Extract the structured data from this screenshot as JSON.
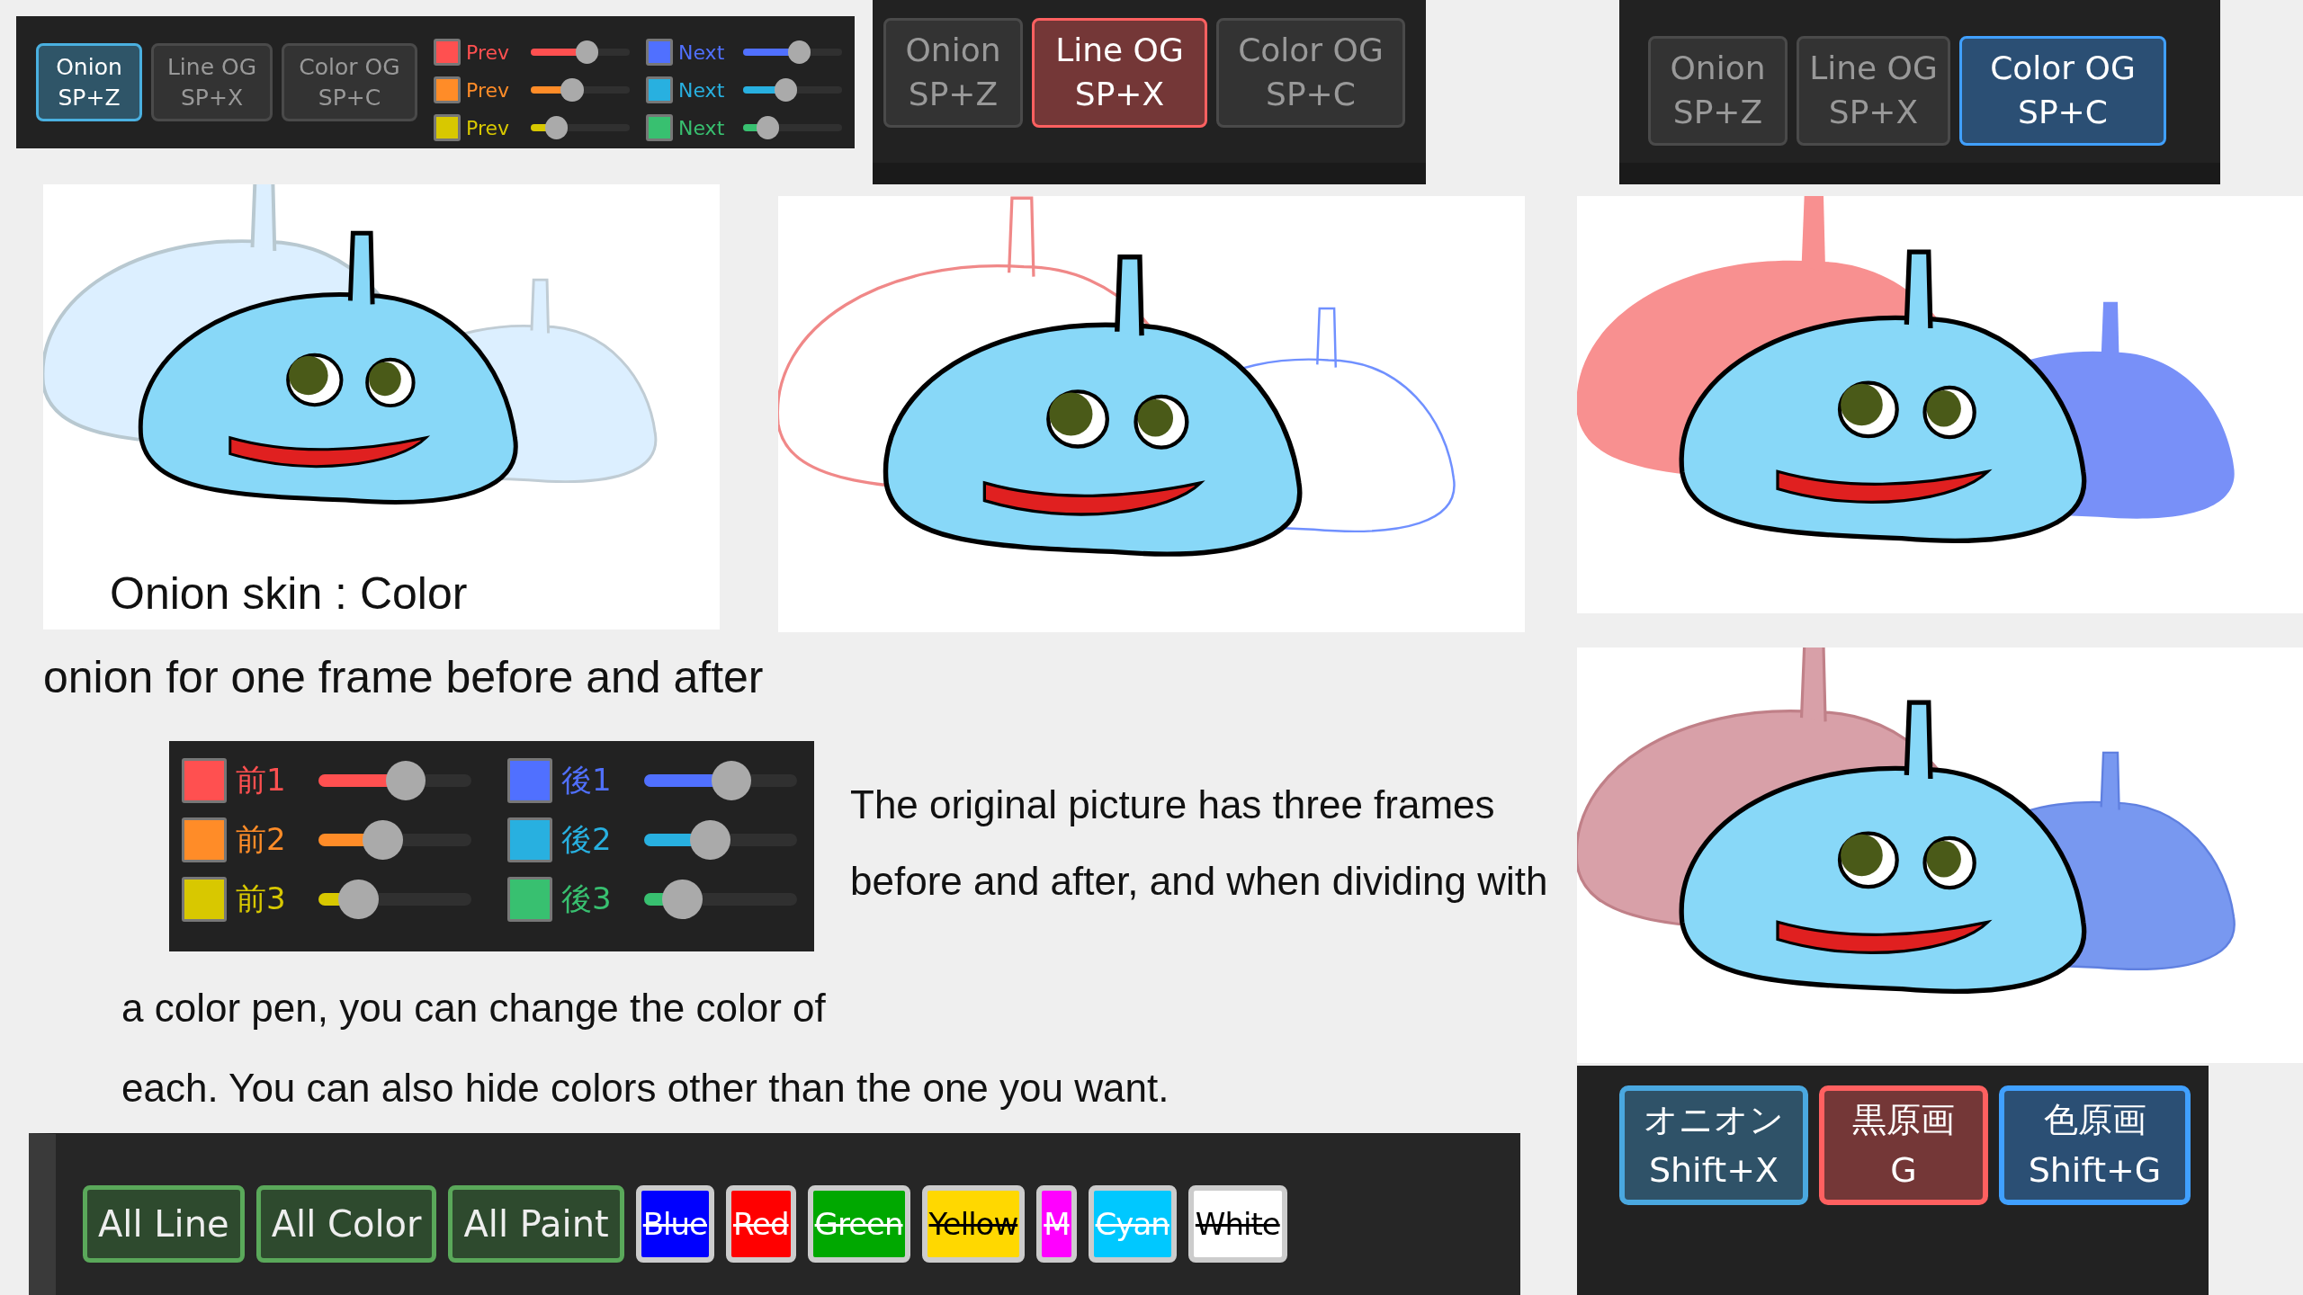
{
  "top_left_toolbar": {
    "mode_buttons": [
      {
        "label": "Onion",
        "shortcut": "SP+Z",
        "selected": true,
        "color": "#4ab0e0"
      },
      {
        "label": "Line OG",
        "shortcut": "SP+X",
        "selected": false
      },
      {
        "label": "Color OG",
        "shortcut": "SP+C",
        "selected": false
      }
    ],
    "prev": [
      {
        "label": "Prev",
        "color": "#ff5050",
        "level": 0.57
      },
      {
        "label": "Prev",
        "color": "#ff8c28",
        "level": 0.42
      },
      {
        "label": "Prev",
        "color": "#d8c800",
        "level": 0.26
      }
    ],
    "next": [
      {
        "label": "Next",
        "color": "#5070ff",
        "level": 0.57
      },
      {
        "label": "Next",
        "color": "#28b0e0",
        "level": 0.43
      },
      {
        "label": "Next",
        "color": "#38c070",
        "level": 0.25
      }
    ]
  },
  "top_middle_toolbar": {
    "mode_buttons": [
      {
        "label": "Onion",
        "shortcut": "SP+Z",
        "selected": false
      },
      {
        "label": "Line OG",
        "shortcut": "SP+X",
        "selected": true,
        "color": "#ff6060"
      },
      {
        "label": "Color OG",
        "shortcut": "SP+C",
        "selected": false
      }
    ]
  },
  "top_right_toolbar": {
    "mode_buttons": [
      {
        "label": "Onion",
        "shortcut": "SP+Z",
        "selected": false
      },
      {
        "label": "Line OG",
        "shortcut": "SP+X",
        "selected": false
      },
      {
        "label": "Color OG",
        "shortcut": "SP+C",
        "selected": true,
        "color": "#40a0ff"
      }
    ]
  },
  "drawings": [
    {
      "kind": "color-onion",
      "caption": "Onion skin : Color"
    },
    {
      "kind": "line-onion"
    },
    {
      "kind": "color-original"
    },
    {
      "kind": "mixed"
    }
  ],
  "caption_line": "onion for one frame before and after",
  "frame_panel": {
    "before": [
      {
        "label": "前1",
        "color": "#ff5050",
        "level": 0.57
      },
      {
        "label": "前2",
        "color": "#ff8c28",
        "level": 0.42
      },
      {
        "label": "前3",
        "color": "#d8c800",
        "level": 0.26
      }
    ],
    "after": [
      {
        "label": "後1",
        "color": "#5070ff",
        "level": 0.57
      },
      {
        "label": "後2",
        "color": "#28b0e0",
        "level": 0.43
      },
      {
        "label": "後3",
        "color": "#38c070",
        "level": 0.25
      }
    ]
  },
  "description": [
    "The original picture has three frames",
    "before and after, and when dividing with",
    "a color pen, you can change the color of",
    "each. You can also hide colors other than the one you want."
  ],
  "filter_bar": {
    "buttons": [
      {
        "kind": "group",
        "label": "All Line"
      },
      {
        "kind": "group",
        "label": "All Color"
      },
      {
        "kind": "group",
        "label": "All Paint"
      },
      {
        "kind": "color",
        "label": "Blue",
        "color": "#0000ff",
        "struck": true
      },
      {
        "kind": "color",
        "label": "Red",
        "color": "#ff0000",
        "struck": true
      },
      {
        "kind": "color",
        "label": "Green",
        "color": "#00a800",
        "struck": true
      },
      {
        "kind": "color",
        "label": "Yellow",
        "color": "#ffd800",
        "struck": true
      },
      {
        "kind": "color",
        "label": "M",
        "color": "#ff00ff",
        "struck": true
      },
      {
        "kind": "color",
        "label": "Cyan",
        "color": "#00c8ff",
        "struck": true
      },
      {
        "kind": "color",
        "label": "White",
        "color": "#ffffff",
        "struck": true
      }
    ]
  },
  "jp_toolbar": {
    "buttons": [
      {
        "label": "オニオン",
        "shortcut": "Shift+X",
        "color": "#4aa8e0"
      },
      {
        "label": "黒原画",
        "shortcut": "G",
        "color": "#ff6060"
      },
      {
        "label": "色原画",
        "shortcut": "Shift+G",
        "color": "#40a0ff"
      }
    ]
  }
}
